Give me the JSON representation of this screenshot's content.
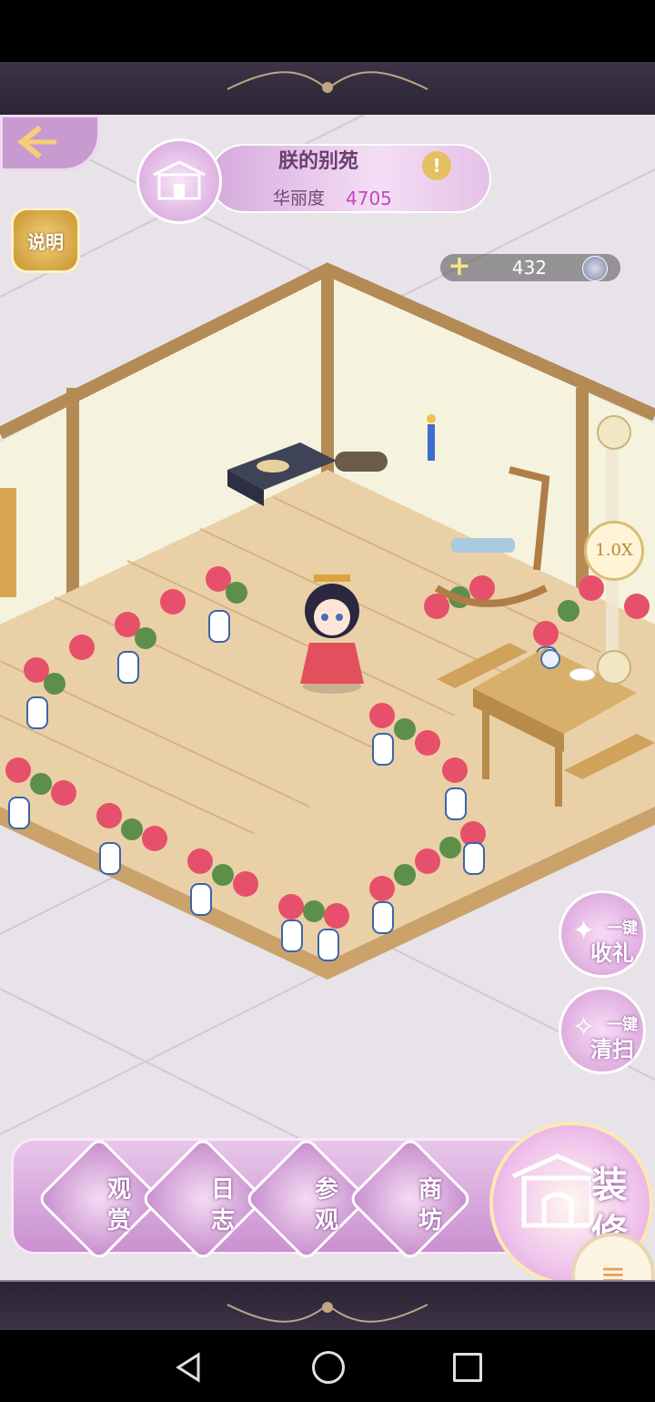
{
  "header": {
    "garden_name": "朕的别苑",
    "info_icon": "exclamation-icon",
    "prestige_label": "华丽度",
    "prestige_value": "4705"
  },
  "explain_button": {
    "label": "说明"
  },
  "currency": {
    "value": "432",
    "add_icon": "plus-icon",
    "icon": "coin-icon"
  },
  "zoom": {
    "label": "1.0X"
  },
  "quick_actions": [
    {
      "line1": "一键",
      "line2": "收礼",
      "icon": "bird-icon"
    },
    {
      "line1": "一键",
      "line2": "清扫",
      "icon": "broom-icon"
    }
  ],
  "menu": [
    {
      "top": "观",
      "bottom": "赏",
      "icon": "pavilion-icon"
    },
    {
      "top": "日",
      "bottom": "志",
      "icon": "scroll-icon"
    },
    {
      "top": "参",
      "bottom": "观",
      "icon": "visit-icon"
    },
    {
      "top": "商",
      "bottom": "坊",
      "icon": "shop-icon"
    }
  ],
  "decorate": {
    "label_top": "装",
    "label_bottom": "修",
    "icon": "gate-icon"
  },
  "menu_toggle": {
    "icon": "hamburger-icon"
  },
  "nav": {
    "back": "back-icon",
    "home": "home-icon",
    "recent": "recent-apps-icon"
  }
}
